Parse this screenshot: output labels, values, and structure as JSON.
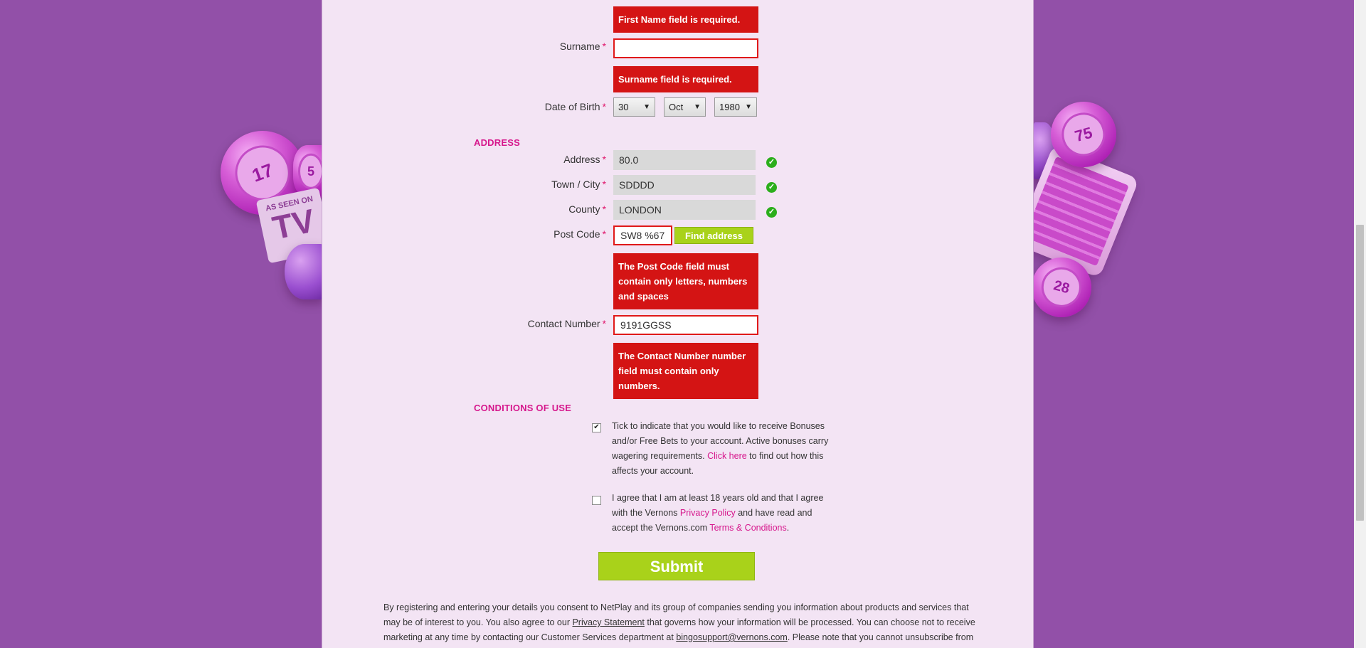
{
  "form": {
    "errors": {
      "first_name": "First Name field is required.",
      "surname": "Surname field is required.",
      "postcode": "The Post Code field must contain only letters, numbers and spaces",
      "contact": "The Contact Number number field must contain only numbers."
    },
    "surname": {
      "label": "Surname",
      "value": ""
    },
    "dob": {
      "label": "Date of Birth",
      "day": "30",
      "month": "Oct",
      "year": "1980"
    },
    "address_section": "ADDRESS",
    "address": {
      "label": "Address",
      "value": "80.0"
    },
    "town": {
      "label": "Town / City",
      "value": "SDDDD"
    },
    "county": {
      "label": "County",
      "value": "LONDON"
    },
    "postcode": {
      "label": "Post Code",
      "value": "SW8 %67",
      "find_button": "Find address"
    },
    "contact": {
      "label": "Contact Number",
      "value": "9191GGSS"
    },
    "required_mark": "*"
  },
  "conditions": {
    "section_title": "CONDITIONS OF USE",
    "bonus": {
      "checked": true,
      "text_before": "Tick to indicate that you would like to receive Bonuses and/or Free Bets to your account. Active bonuses carry wagering requirements.",
      "link": "Click here",
      "text_after": "to find out how this affects your account."
    },
    "age": {
      "checked": false,
      "text_before": "I agree that I am at least 18 years old and that I agree with the Vernons",
      "privacy_link": "Privacy Policy",
      "text_mid": "and have read and accept the Vernons.com",
      "terms_link": "Terms & Conditions",
      "text_end": "."
    }
  },
  "submit_label": "Submit",
  "footer": {
    "text1": "By registering and entering your details you consent to NetPlay and its group of companies sending you information about products and services that may be of interest to you. You also agree to our",
    "privacy_link": "Privacy Statement",
    "text2": "that governs how your information will be processed. You can choose not to receive marketing at any time by contacting our Customer Services department at",
    "email_link": "bingosupport@vernons.com",
    "text3": ". Please note that you cannot unsubscribe from"
  },
  "decor": {
    "balls": [
      "17",
      "5",
      "75",
      "28"
    ],
    "tv_small": "AS SEEN ON",
    "tv_big": "TV"
  },
  "colors": {
    "background": "#9250a8",
    "panel": "#f3e4f4",
    "error": "#d41414",
    "accent": "#d6178c",
    "button": "#a9d21a"
  }
}
